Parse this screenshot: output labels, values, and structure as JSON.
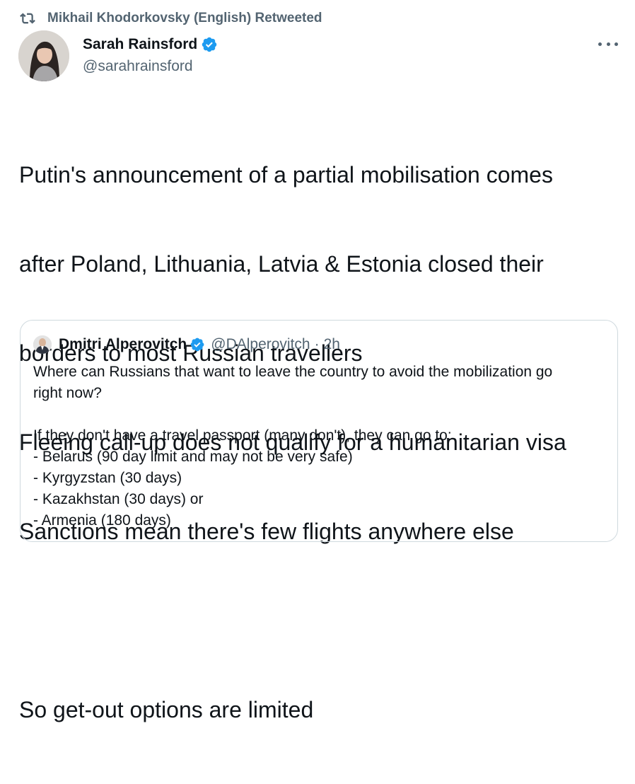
{
  "retweet": {
    "label": "Mikhail Khodorkovsky (English) Retweeted"
  },
  "author": {
    "name": "Sarah Rainsford",
    "handle": "@sarahrainsford"
  },
  "tweet": {
    "lines": [
      "Putin's announcement of a partial mobilisation comes",
      "after Poland, Lithuania, Latvia & Estonia closed their",
      "borders to most Russian travellers",
      "Fleeing call-up does not qualify for a humanitarian visa",
      "Sanctions mean there's few flights anywhere else",
      "",
      "So get-out options are limited"
    ]
  },
  "quote": {
    "name": "Dmitri Alperovitch",
    "handle": "@DAlperovitch",
    "separator": "·",
    "time": "2h",
    "lines": [
      "Where can Russians that want to leave the country to avoid the mobilization go",
      "right now?",
      "",
      "If they don't have a travel passport (many don't), they can go to:",
      "- Belarus (90 day limit and may not be very safe)",
      "- Kyrgyzstan (30 days)",
      "- Kazakhstan (30 days) or",
      "- Armenia (180 days)"
    ]
  },
  "colors": {
    "secondary_text": "#536471",
    "verified_blue": "#1d9bf0",
    "border": "#cfd9de"
  },
  "icons": {
    "retweet": "retweet-icon",
    "verified": "verified-badge-icon",
    "more": "more-dots-icon"
  }
}
